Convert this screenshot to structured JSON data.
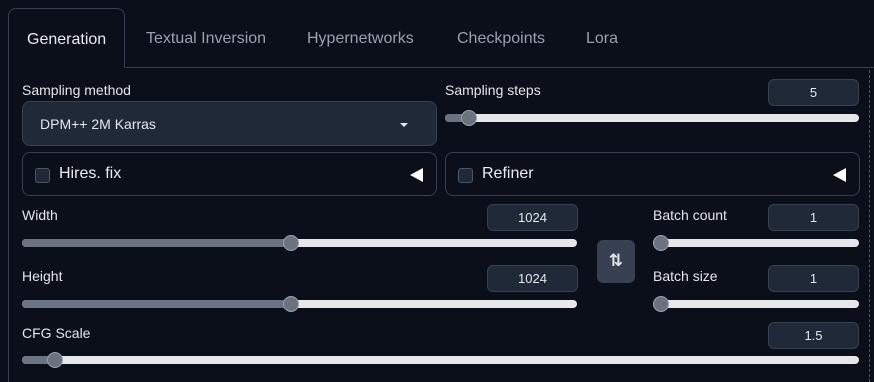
{
  "tabs": {
    "generation": "Generation",
    "textual_inversion": "Textual Inversion",
    "hypernetworks": "Hypernetworks",
    "checkpoints": "Checkpoints",
    "lora": "Lora",
    "active": "Generation"
  },
  "sampling_method": {
    "label": "Sampling method",
    "value": "DPM++ 2M Karras",
    "icon": "chevron-down-icon"
  },
  "sampling_steps": {
    "label": "Sampling steps",
    "value": "5",
    "slider_fraction": 0.04
  },
  "hires_fix": {
    "label": "Hires. fix",
    "checked": false,
    "icon": "collapse-triangle-icon"
  },
  "refiner": {
    "label": "Refiner",
    "checked": false,
    "icon": "collapse-triangle-icon"
  },
  "width": {
    "label": "Width",
    "value": "1024",
    "slider_fraction": 0.485
  },
  "height": {
    "label": "Height",
    "value": "1024",
    "slider_fraction": 0.485
  },
  "swap_button": {
    "icon": "swap-vertical-icon",
    "glyph": "⇅"
  },
  "batch_count": {
    "label": "Batch count",
    "value": "1",
    "slider_fraction": 0.0
  },
  "batch_size": {
    "label": "Batch size",
    "value": "1",
    "slider_fraction": 0.0
  },
  "cfg_scale": {
    "label": "CFG Scale",
    "value": "1.5",
    "slider_fraction": 0.03
  },
  "colors": {
    "background": "#0b0f19",
    "input_bg": "#1f2937",
    "border": "#374151",
    "slider_track": "#e5e7eb",
    "slider_fill": "#6b7280"
  }
}
